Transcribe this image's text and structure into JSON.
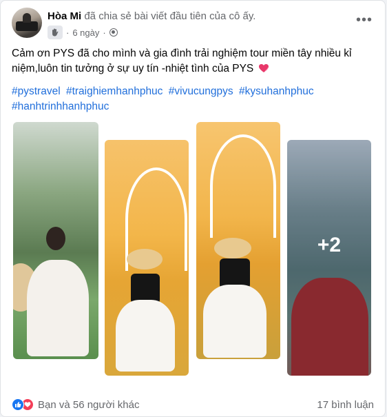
{
  "post": {
    "author": "Hòa Mi",
    "action": "đã chia sẻ bài viết đầu tiên của cô ấy.",
    "time": "6 ngày",
    "separator": "·",
    "more": "•••",
    "text": "Cảm ơn PYS đã cho mình và gia đình trải nghiệm tour miền tây nhiều kỉ niệm,luôn tin tưởng ở sự uy tín -nhiệt tình của PYS",
    "hashtags": [
      "#pystravel",
      "#traighiemhanhphuc",
      "#vivucungpys",
      "#kysuhanhphuc",
      "#hanhtrinhhanhphuc"
    ],
    "more_photos": "+2"
  },
  "footer": {
    "reactions_text": "Bạn và 56 người khác",
    "comments_text": "17 bình luận"
  },
  "colors": {
    "link": "#216fdb",
    "like": "#1877f2",
    "love": "#f33e58"
  }
}
